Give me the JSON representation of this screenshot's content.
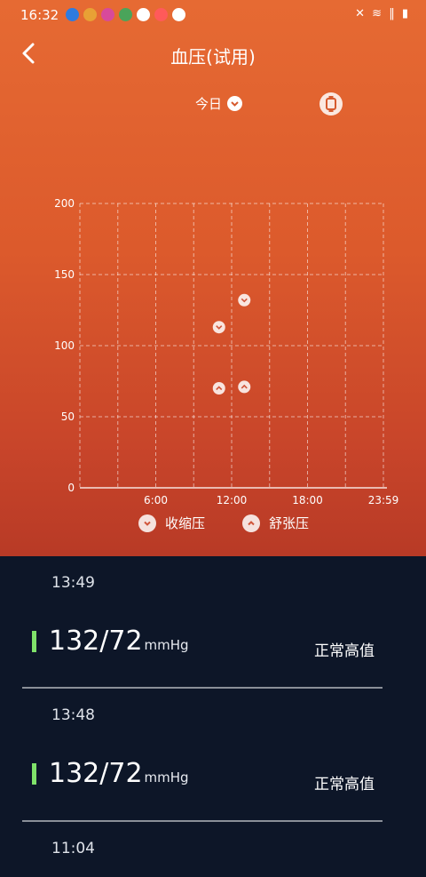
{
  "status_bar": {
    "time": "16:32",
    "app_icon_colors": [
      "#2e7be0",
      "#e8a135",
      "#d84a9a",
      "#4aa45a",
      "#ffffff",
      "#ff5a5a",
      "#ffffff"
    ],
    "system_icons": "✕ ≋ ‖ ▮"
  },
  "header": {
    "title": "血压(试用)",
    "date_selector": "今日"
  },
  "chart_data": {
    "type": "scatter",
    "x_tick_labels": [
      "6:00",
      "12:00",
      "18:00",
      "23:59"
    ],
    "y_tick_labels": [
      "200",
      "150",
      "100",
      "50",
      "0"
    ],
    "xlim": [
      0,
      24
    ],
    "ylim": [
      0,
      200
    ],
    "grid": true,
    "series": [
      {
        "name": "收缩压",
        "points": [
          {
            "x": 11.0,
            "y": 113
          },
          {
            "x": 13.0,
            "y": 132
          }
        ]
      },
      {
        "name": "舒张压",
        "points": [
          {
            "x": 11.0,
            "y": 70
          },
          {
            "x": 13.0,
            "y": 71
          }
        ]
      }
    ]
  },
  "legend": {
    "systolic": "收缩压",
    "diastolic": "舒张压"
  },
  "records": [
    {
      "time": "13:49",
      "value": "132/72",
      "unit": "mmHg",
      "status": "正常高值"
    },
    {
      "time": "13:48",
      "value": "132/72",
      "unit": "mmHg",
      "status": "正常高值"
    },
    {
      "time": "11:04"
    }
  ],
  "colors": {
    "accent_top": "#e66a33",
    "accent_bottom": "#b83a26",
    "list_bg": "#0d1628",
    "status_bar_green": "#7fe26a"
  }
}
